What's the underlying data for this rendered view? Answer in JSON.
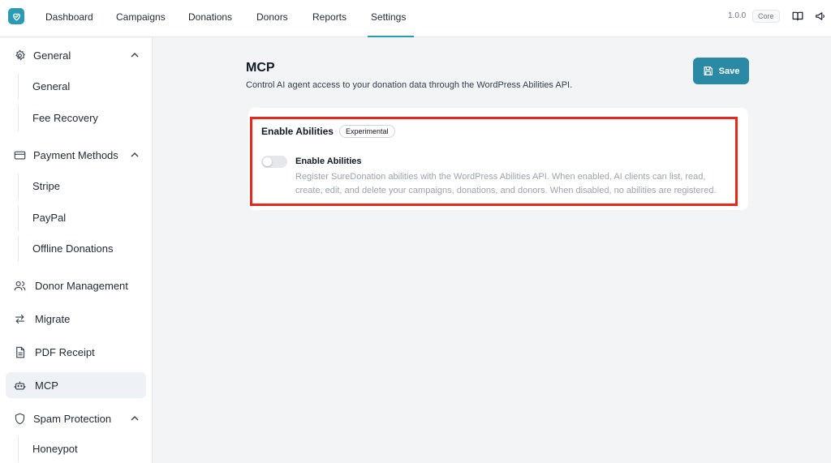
{
  "nav": {
    "items": [
      "Dashboard",
      "Campaigns",
      "Donations",
      "Donors",
      "Reports",
      "Settings"
    ],
    "active": "Settings",
    "version": "1.0.0",
    "edition": "Core"
  },
  "sidebar": {
    "general": {
      "label": "General",
      "children": [
        "General",
        "Fee Recovery"
      ]
    },
    "payment_methods": {
      "label": "Payment Methods",
      "children": [
        "Stripe",
        "PayPal",
        "Offline Donations"
      ]
    },
    "donor_management": "Donor Management",
    "migrate": "Migrate",
    "pdf_receipt": "PDF Receipt",
    "mcp": "MCP",
    "spam_protection": {
      "label": "Spam Protection",
      "children": [
        "Honeypot"
      ]
    }
  },
  "main": {
    "title": "MCP",
    "description": "Control AI agent access to your donation data through the WordPress Abilities API.",
    "save_label": "Save",
    "card": {
      "title": "Enable Abilities",
      "badge": "Experimental",
      "toggle_label": "Enable Abilities",
      "toggle_enabled": false,
      "toggle_description": "Register SureDonation abilities with the WordPress Abilities API. When enabled, AI clients can list, read, create, edit, and delete your campaigns, donations, and donors. When disabled, no abilities are registered."
    }
  },
  "colors": {
    "accent": "#2a8aa6",
    "highlight": "#e8261a"
  }
}
